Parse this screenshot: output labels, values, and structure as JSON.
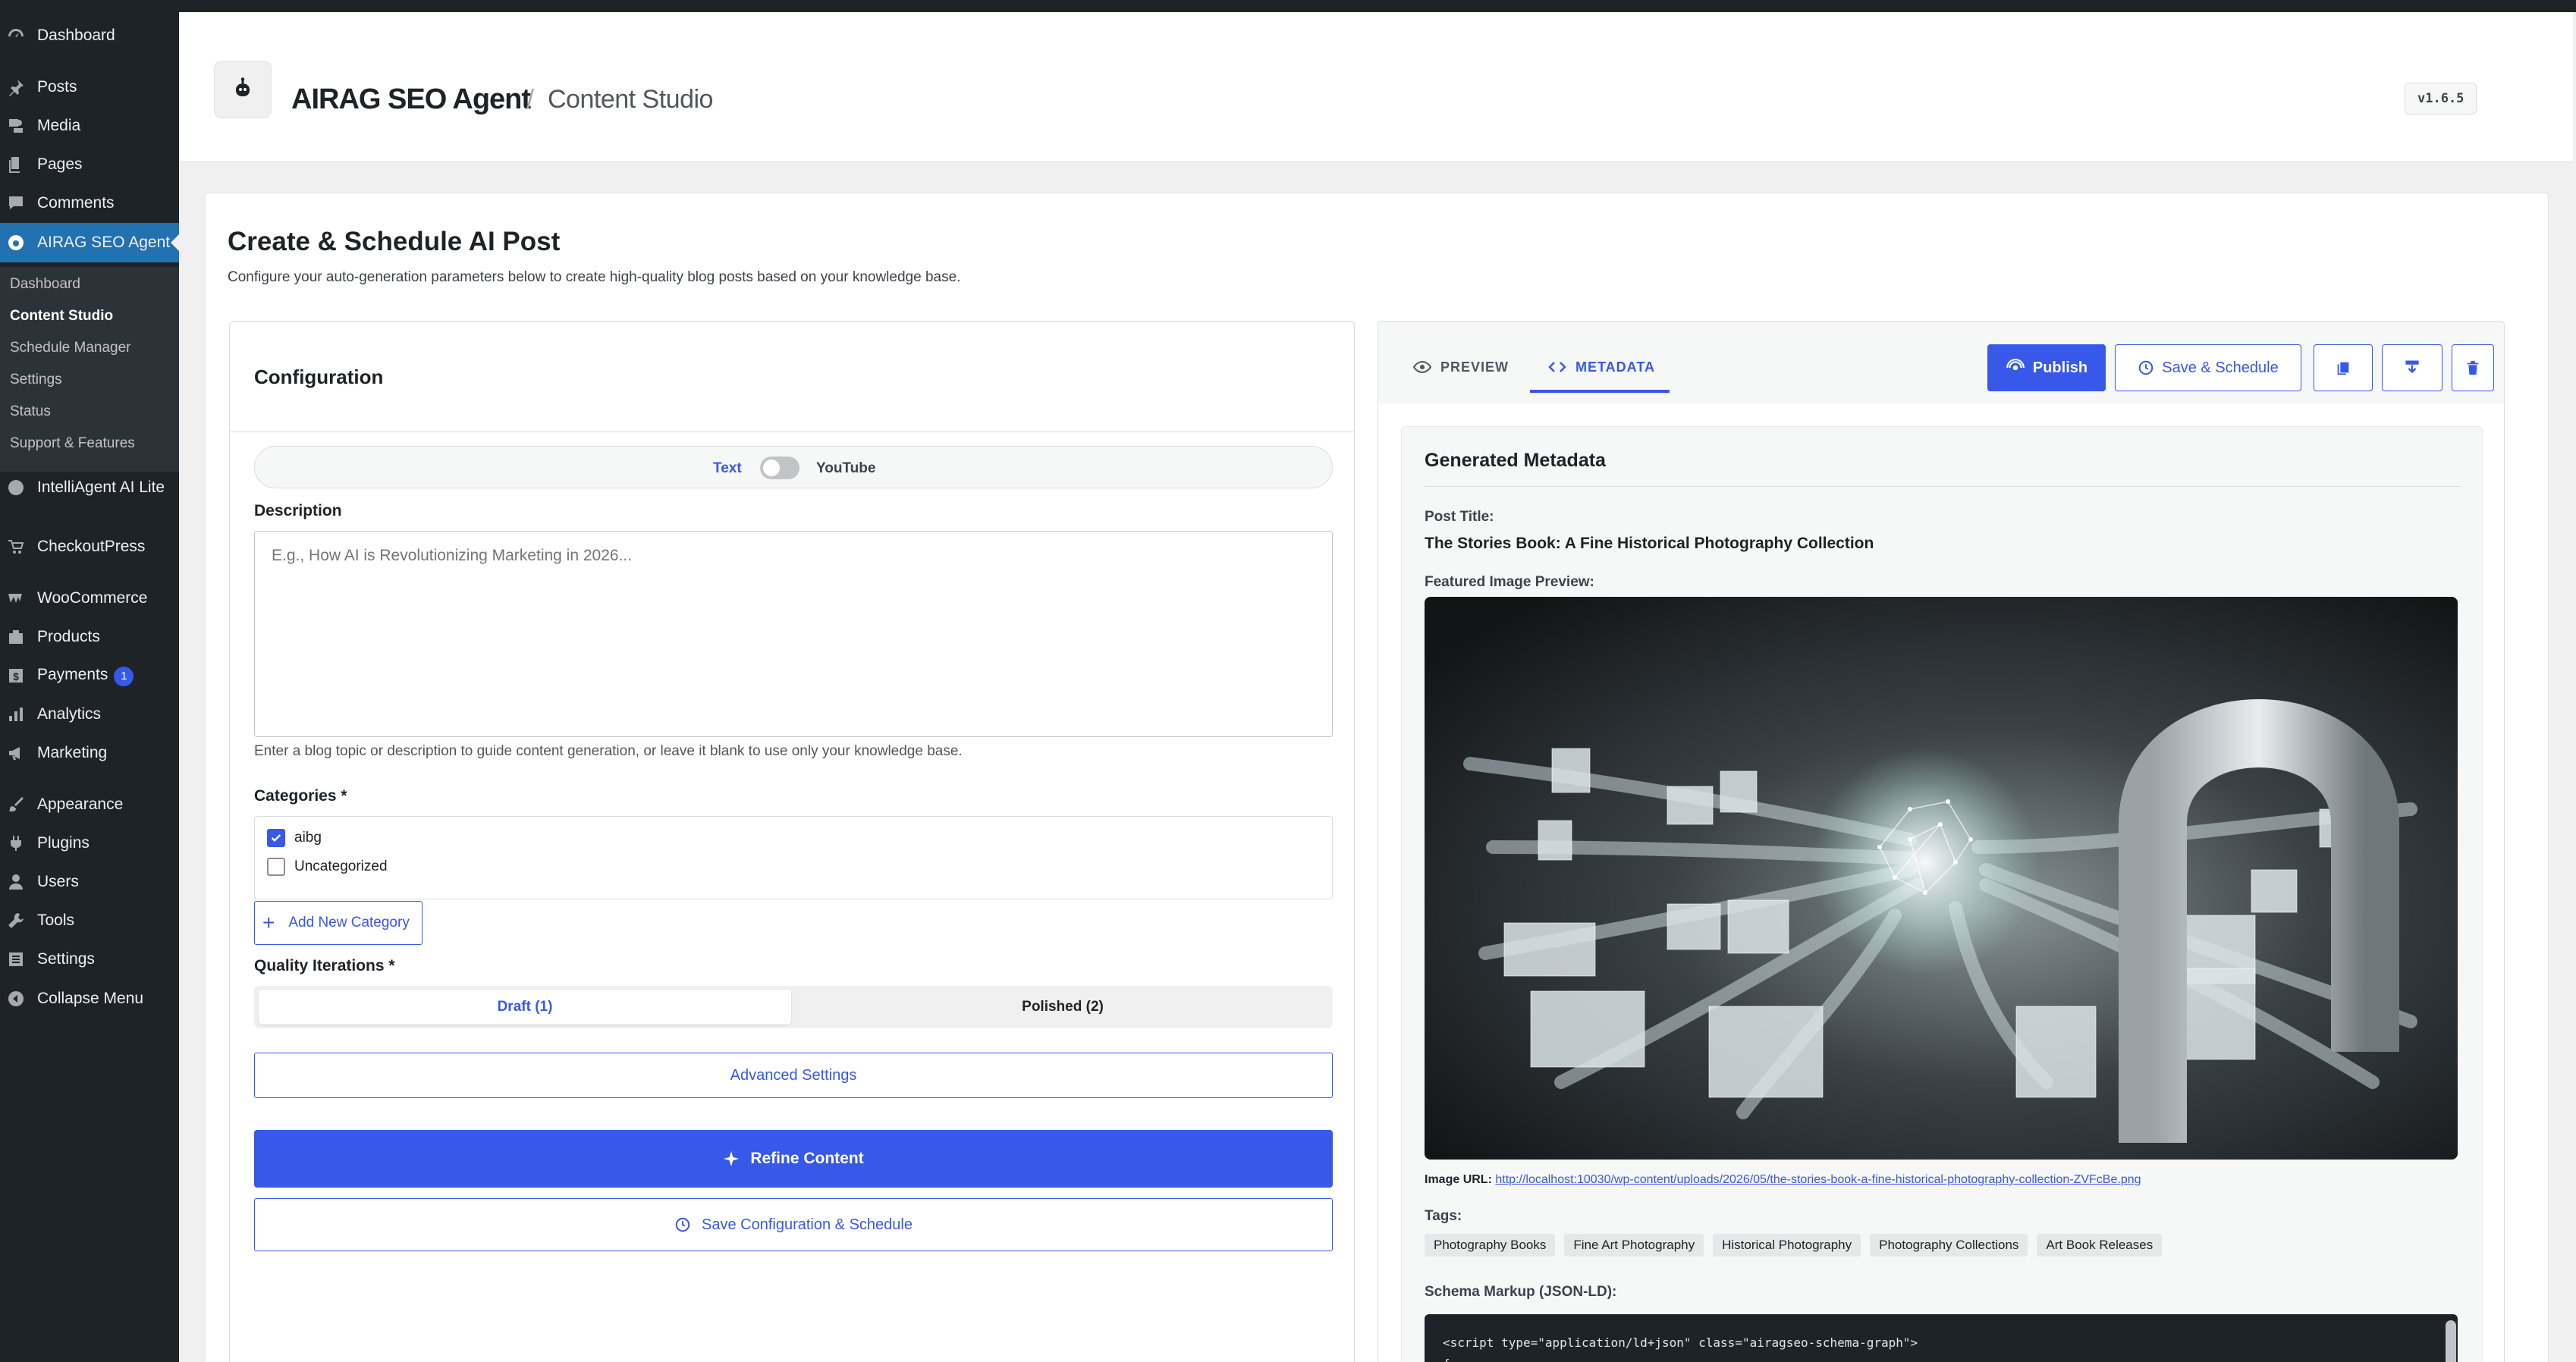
{
  "sidebar": {
    "items": [
      {
        "label": "Dashboard",
        "icon": "dashboard-icon"
      },
      {
        "label": "Posts",
        "icon": "pin-icon"
      },
      {
        "label": "Media",
        "icon": "media-icon"
      },
      {
        "label": "Pages",
        "icon": "pages-icon"
      },
      {
        "label": "Comments",
        "icon": "comments-icon"
      },
      {
        "label": "AIRAG SEO Agent",
        "icon": "agent-icon"
      },
      {
        "label": "IntelliAgent AI Lite",
        "icon": "intelliagent-icon"
      },
      {
        "label": "CheckoutPress",
        "icon": "cart-icon"
      },
      {
        "label": "WooCommerce",
        "icon": "woo-icon"
      },
      {
        "label": "Products",
        "icon": "products-icon"
      },
      {
        "label": "Payments",
        "icon": "payments-icon",
        "badge": "1"
      },
      {
        "label": "Analytics",
        "icon": "analytics-icon"
      },
      {
        "label": "Marketing",
        "icon": "megaphone-icon"
      },
      {
        "label": "Appearance",
        "icon": "brush-icon"
      },
      {
        "label": "Plugins",
        "icon": "plugin-icon"
      },
      {
        "label": "Users",
        "icon": "users-icon"
      },
      {
        "label": "Tools",
        "icon": "wrench-icon"
      },
      {
        "label": "Settings",
        "icon": "settings-icon"
      },
      {
        "label": "Collapse Menu",
        "icon": "collapse-icon"
      }
    ],
    "submenu": [
      "Dashboard",
      "Content Studio",
      "Schedule Manager",
      "Settings",
      "Status",
      "Support & Features"
    ]
  },
  "header": {
    "brand": "AIRAG SEO Agent",
    "separator": "/",
    "section": "Content Studio",
    "version": "v1.6.5"
  },
  "page": {
    "title": "Create & Schedule AI Post",
    "description": "Configure your auto-generation parameters below to create high-quality blog posts based on your knowledge base."
  },
  "config": {
    "title": "Configuration",
    "mode_text": "Text",
    "mode_youtube": "YouTube",
    "description_label": "Description",
    "description_placeholder": "E.g., How AI is Revolutionizing Marketing in 2026...",
    "description_hint": "Enter a blog topic or description to guide content generation, or leave it blank to use only your knowledge base.",
    "categories_label": "Categories *",
    "categories": [
      {
        "label": "aibg",
        "checked": true
      },
      {
        "label": "Uncategorized",
        "checked": false
      }
    ],
    "add_category": "Add New Category",
    "quality_label": "Quality Iterations *",
    "quality_draft": "Draft (1)",
    "quality_polished": "Polished (2)",
    "advanced": "Advanced Settings",
    "refine": "Refine Content",
    "save_schedule": "Save Configuration & Schedule"
  },
  "output": {
    "tab_preview": "PREVIEW",
    "tab_metadata": "METADATA",
    "publish": "Publish",
    "save_schedule": "Save & Schedule",
    "meta_title": "Generated Metadata",
    "post_title_label": "Post Title:",
    "post_title": "The Stories Book: A Fine Historical Photography Collection",
    "featured_label": "Featured Image Preview:",
    "image_url_label": "Image URL:",
    "image_url": "http://localhost:10030/wp-content/uploads/2026/05/the-stories-book-a-fine-historical-photography-collection-ZVFcBe.png",
    "tags_label": "Tags:",
    "tags": [
      "Photography Books",
      "Fine Art Photography",
      "Historical Photography",
      "Photography Collections",
      "Art Book Releases"
    ],
    "schema_label": "Schema Markup (JSON-LD):",
    "schema_line1": "<script type=\"application/ld+json\" class=\"airagseo-schema-graph\">",
    "schema_line2": "{"
  },
  "colors": {
    "accent": "#3858e9",
    "wp_blue": "#2271b1",
    "sidebar": "#1d2327"
  }
}
